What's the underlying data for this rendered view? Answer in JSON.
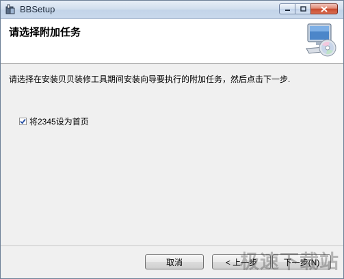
{
  "window": {
    "title": "BBSetup",
    "icons": {
      "app": "installer-icon",
      "minimize": "minimize-icon",
      "maximize": "maximize-icon",
      "close": "close-icon"
    }
  },
  "header": {
    "title": "请选择附加任务",
    "art_icon": "computer-cd-icon"
  },
  "body": {
    "instruction": "请选择在安装贝贝装修工具期间安装向导要执行的附加任务，然后点击下一步.",
    "task": {
      "label": "将2345设为首页",
      "checked": true
    }
  },
  "footer": {
    "cancel_label": "取消",
    "back_label": "< 上一步",
    "next_label": "下一步(N)"
  },
  "watermark": {
    "text": "极速下载站"
  },
  "colors": {
    "titlebar": "#c9d9ec",
    "close_button": "#c84a2e",
    "panel": "#f0f0f0",
    "check_mark": "#1f4aa0"
  }
}
